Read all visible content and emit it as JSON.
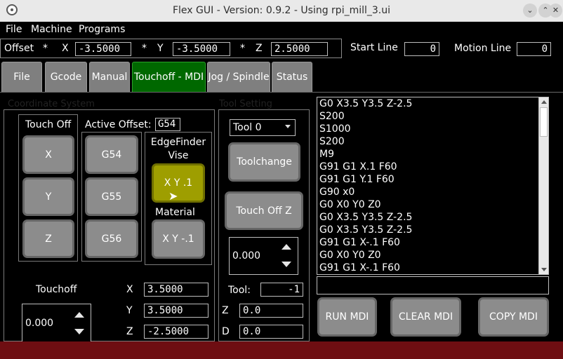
{
  "window": {
    "title": "Flex GUI - Version: 0.9.2 - Using rpi_mill_3.ui"
  },
  "titlebar_buttons": {
    "minimize": "⌄",
    "restore": "⌃",
    "close": "✕"
  },
  "menu": [
    "File",
    "Machine",
    "Programs"
  ],
  "offset_bar": {
    "label": "Offset",
    "x_mark": "*",
    "x_label": "X",
    "x_value": "-3.5000",
    "y_mark": "*",
    "y_label": "Y",
    "y_value": "-3.5000",
    "z_mark": "*",
    "z_label": "Z",
    "z_value": "2.5000"
  },
  "start_line": {
    "label": "Start Line",
    "value": "0"
  },
  "motion_line": {
    "label": "Motion Line",
    "value": "0"
  },
  "tabs": [
    "File",
    "Gcode",
    "Manual",
    "Touchoff - MDI",
    "Jog / Spindle",
    "Status"
  ],
  "active_tab": "Touchoff - MDI",
  "coordinate_system": {
    "title": "Coordinate System",
    "touch_off_label": "Touch Off",
    "touch_buttons": [
      "X",
      "Y",
      "Z"
    ],
    "active_offset_label": "Active Offset:",
    "active_offset_value": "G54",
    "offset_buttons": [
      "G54",
      "G55",
      "G56"
    ],
    "edgefinder_label": "EdgeFinder Vise",
    "edgefinder_button": "X Y .1",
    "material_label": "Material",
    "material_button": "X Y -.1",
    "touchoff_label": "Touchoff",
    "touchoff_value": "0.000",
    "positions": [
      {
        "axis": "X",
        "value": "3.5000"
      },
      {
        "axis": "Y",
        "value": "3.5000"
      },
      {
        "axis": "Z",
        "value": "-2.5000"
      }
    ]
  },
  "tool_setting": {
    "title": "Tool Setting",
    "tool_select": "Tool 0",
    "toolchange_button": "Toolchange",
    "touch_off_z_button": "Touch Off Z",
    "spin_value": "0.000",
    "tool_label": "Tool:",
    "tool_value": "-1",
    "z_label": "Z",
    "z_value": "0.0",
    "d_label": "D",
    "d_value": "0.0"
  },
  "mdi": {
    "history": [
      "G0 X3.5 Y3.5 Z-2.5",
      "S200",
      "S1000",
      "S200",
      "M9",
      "G91 G1 X.1 F60",
      "G91 G1 Y.1 F60",
      "G90 x0",
      "G0 X0 Y0 Z0",
      "G0 X3.5 Y3.5 Z-2.5",
      "G0 X3.5 Y3.5 Z-2.5",
      "G91 G1 X-.1 F60",
      "G0 X0 Y0 Z0",
      "G91 G1 X-.1 F60"
    ],
    "input_value": "",
    "run_button": "RUN MDI",
    "clear_button": "CLEAR MDI",
    "copy_button": "COPY MDI"
  },
  "colors": {
    "active_tab": "#006800",
    "highlight_button": "#9e9e00",
    "footer": "#6e0e12"
  }
}
